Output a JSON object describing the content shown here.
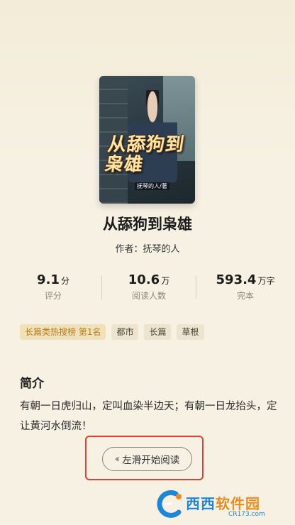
{
  "book": {
    "cover_title_art": "从舔狗到枭雄",
    "cover_author_art": "抚琴的人/著",
    "title": "从舔狗到枭雄",
    "author_line": "作者：抚琴的人"
  },
  "stats": [
    {
      "value": "9.1",
      "unit": "分",
      "label": "评分"
    },
    {
      "value": "10.6",
      "unit": "万",
      "label": "阅读人数"
    },
    {
      "value": "593.4",
      "unit": "万字",
      "label": "完本"
    }
  ],
  "tags": [
    {
      "label": "长篇类热搜榜  第1名",
      "type": "rank"
    },
    {
      "label": "都市",
      "type": "normal"
    },
    {
      "label": "长篇",
      "type": "normal"
    },
    {
      "label": "草根",
      "type": "normal"
    }
  ],
  "intro": {
    "heading": "简介",
    "text": "有朝一日虎归山，定叫血染半边天；有朝一日龙抬头，定让黄河水倒流！"
  },
  "actions": {
    "read_button_icon": "double-chevron-left-icon",
    "read_button_label": "左滑开始阅读"
  },
  "watermark": {
    "brand_blue": "西西",
    "brand_orange": "软件园",
    "url": "CR173.com"
  },
  "colors": {
    "background": "#f7f1e3",
    "rank_tag_text": "#b77b1b",
    "highlight_box": "#e04034",
    "watermark_blue": "#1e86d6",
    "watermark_orange": "#f08a1a"
  }
}
